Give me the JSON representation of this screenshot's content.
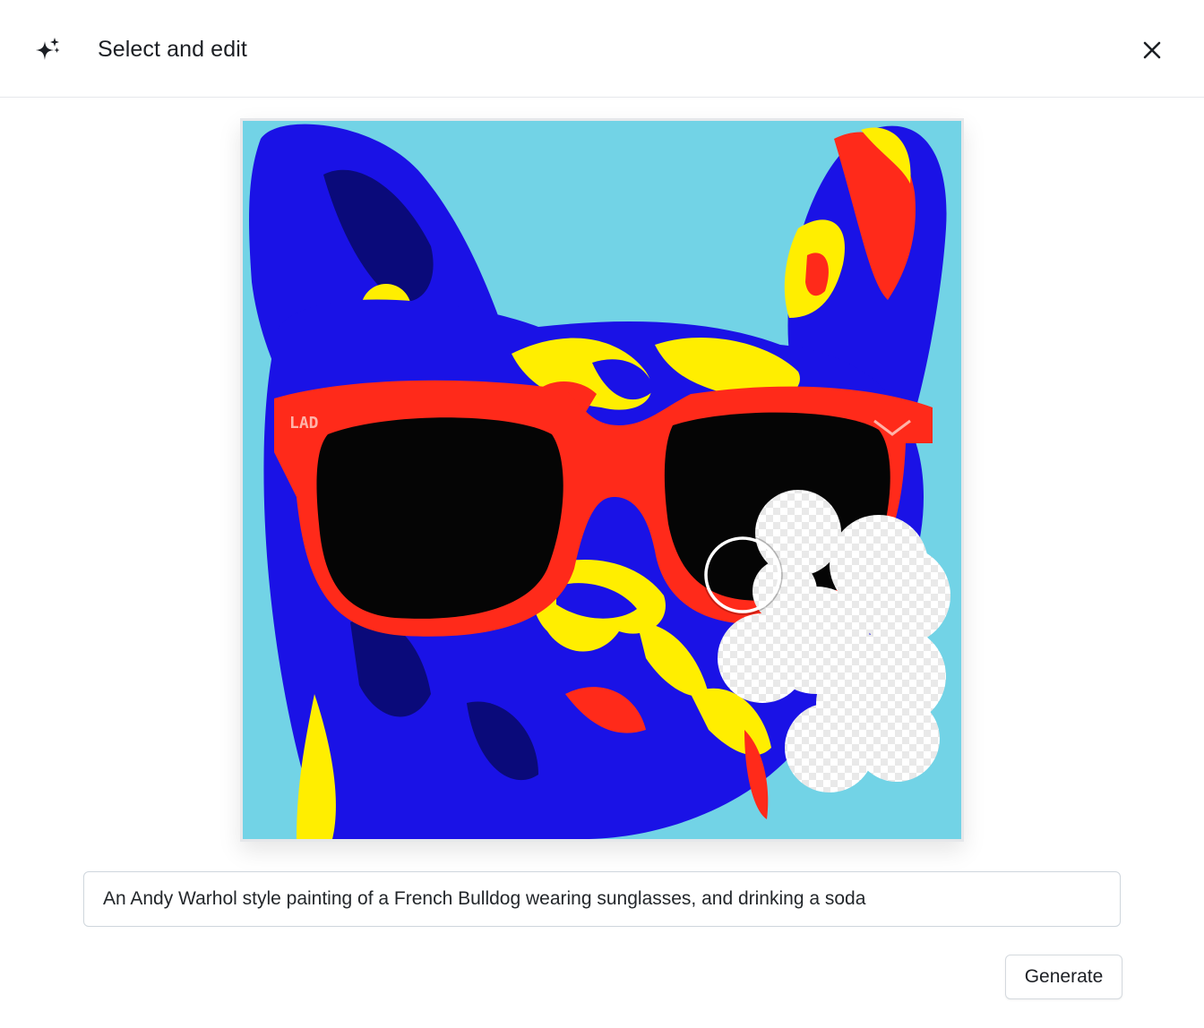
{
  "header": {
    "title": "Select and edit",
    "icon": "sparkle-icon",
    "close_icon": "close-icon"
  },
  "editor": {
    "image_subject": "French Bulldog pop-art painting with red sunglasses",
    "brush_tool": "circle-brush-cursor",
    "erased_region": "transparent-checker-mask",
    "sunglasses_text": "LAD"
  },
  "prompt": {
    "value": "An Andy Warhol style painting of a French Bulldog wearing sunglasses, and drinking a soda",
    "placeholder": ""
  },
  "actions": {
    "generate_label": "Generate"
  },
  "colors": {
    "background": "#72d3e6",
    "dog_blue": "#1a12e6",
    "glasses_red": "#ff2a1a",
    "highlight_yellow": "#ffee00",
    "lens_black": "#050505"
  }
}
